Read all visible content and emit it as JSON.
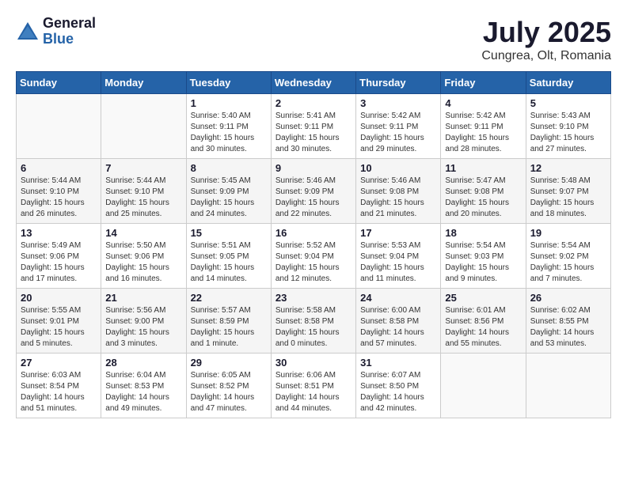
{
  "header": {
    "logo_general": "General",
    "logo_blue": "Blue",
    "month_year": "July 2025",
    "location": "Cungrea, Olt, Romania"
  },
  "days_of_week": [
    "Sunday",
    "Monday",
    "Tuesday",
    "Wednesday",
    "Thursday",
    "Friday",
    "Saturday"
  ],
  "weeks": [
    [
      {
        "day": "",
        "info": ""
      },
      {
        "day": "",
        "info": ""
      },
      {
        "day": "1",
        "info": "Sunrise: 5:40 AM\nSunset: 9:11 PM\nDaylight: 15 hours\nand 30 minutes."
      },
      {
        "day": "2",
        "info": "Sunrise: 5:41 AM\nSunset: 9:11 PM\nDaylight: 15 hours\nand 30 minutes."
      },
      {
        "day": "3",
        "info": "Sunrise: 5:42 AM\nSunset: 9:11 PM\nDaylight: 15 hours\nand 29 minutes."
      },
      {
        "day": "4",
        "info": "Sunrise: 5:42 AM\nSunset: 9:11 PM\nDaylight: 15 hours\nand 28 minutes."
      },
      {
        "day": "5",
        "info": "Sunrise: 5:43 AM\nSunset: 9:10 PM\nDaylight: 15 hours\nand 27 minutes."
      }
    ],
    [
      {
        "day": "6",
        "info": "Sunrise: 5:44 AM\nSunset: 9:10 PM\nDaylight: 15 hours\nand 26 minutes."
      },
      {
        "day": "7",
        "info": "Sunrise: 5:44 AM\nSunset: 9:10 PM\nDaylight: 15 hours\nand 25 minutes."
      },
      {
        "day": "8",
        "info": "Sunrise: 5:45 AM\nSunset: 9:09 PM\nDaylight: 15 hours\nand 24 minutes."
      },
      {
        "day": "9",
        "info": "Sunrise: 5:46 AM\nSunset: 9:09 PM\nDaylight: 15 hours\nand 22 minutes."
      },
      {
        "day": "10",
        "info": "Sunrise: 5:46 AM\nSunset: 9:08 PM\nDaylight: 15 hours\nand 21 minutes."
      },
      {
        "day": "11",
        "info": "Sunrise: 5:47 AM\nSunset: 9:08 PM\nDaylight: 15 hours\nand 20 minutes."
      },
      {
        "day": "12",
        "info": "Sunrise: 5:48 AM\nSunset: 9:07 PM\nDaylight: 15 hours\nand 18 minutes."
      }
    ],
    [
      {
        "day": "13",
        "info": "Sunrise: 5:49 AM\nSunset: 9:06 PM\nDaylight: 15 hours\nand 17 minutes."
      },
      {
        "day": "14",
        "info": "Sunrise: 5:50 AM\nSunset: 9:06 PM\nDaylight: 15 hours\nand 16 minutes."
      },
      {
        "day": "15",
        "info": "Sunrise: 5:51 AM\nSunset: 9:05 PM\nDaylight: 15 hours\nand 14 minutes."
      },
      {
        "day": "16",
        "info": "Sunrise: 5:52 AM\nSunset: 9:04 PM\nDaylight: 15 hours\nand 12 minutes."
      },
      {
        "day": "17",
        "info": "Sunrise: 5:53 AM\nSunset: 9:04 PM\nDaylight: 15 hours\nand 11 minutes."
      },
      {
        "day": "18",
        "info": "Sunrise: 5:54 AM\nSunset: 9:03 PM\nDaylight: 15 hours\nand 9 minutes."
      },
      {
        "day": "19",
        "info": "Sunrise: 5:54 AM\nSunset: 9:02 PM\nDaylight: 15 hours\nand 7 minutes."
      }
    ],
    [
      {
        "day": "20",
        "info": "Sunrise: 5:55 AM\nSunset: 9:01 PM\nDaylight: 15 hours\nand 5 minutes."
      },
      {
        "day": "21",
        "info": "Sunrise: 5:56 AM\nSunset: 9:00 PM\nDaylight: 15 hours\nand 3 minutes."
      },
      {
        "day": "22",
        "info": "Sunrise: 5:57 AM\nSunset: 8:59 PM\nDaylight: 15 hours\nand 1 minute."
      },
      {
        "day": "23",
        "info": "Sunrise: 5:58 AM\nSunset: 8:58 PM\nDaylight: 15 hours\nand 0 minutes."
      },
      {
        "day": "24",
        "info": "Sunrise: 6:00 AM\nSunset: 8:58 PM\nDaylight: 14 hours\nand 57 minutes."
      },
      {
        "day": "25",
        "info": "Sunrise: 6:01 AM\nSunset: 8:56 PM\nDaylight: 14 hours\nand 55 minutes."
      },
      {
        "day": "26",
        "info": "Sunrise: 6:02 AM\nSunset: 8:55 PM\nDaylight: 14 hours\nand 53 minutes."
      }
    ],
    [
      {
        "day": "27",
        "info": "Sunrise: 6:03 AM\nSunset: 8:54 PM\nDaylight: 14 hours\nand 51 minutes."
      },
      {
        "day": "28",
        "info": "Sunrise: 6:04 AM\nSunset: 8:53 PM\nDaylight: 14 hours\nand 49 minutes."
      },
      {
        "day": "29",
        "info": "Sunrise: 6:05 AM\nSunset: 8:52 PM\nDaylight: 14 hours\nand 47 minutes."
      },
      {
        "day": "30",
        "info": "Sunrise: 6:06 AM\nSunset: 8:51 PM\nDaylight: 14 hours\nand 44 minutes."
      },
      {
        "day": "31",
        "info": "Sunrise: 6:07 AM\nSunset: 8:50 PM\nDaylight: 14 hours\nand 42 minutes."
      },
      {
        "day": "",
        "info": ""
      },
      {
        "day": "",
        "info": ""
      }
    ]
  ]
}
